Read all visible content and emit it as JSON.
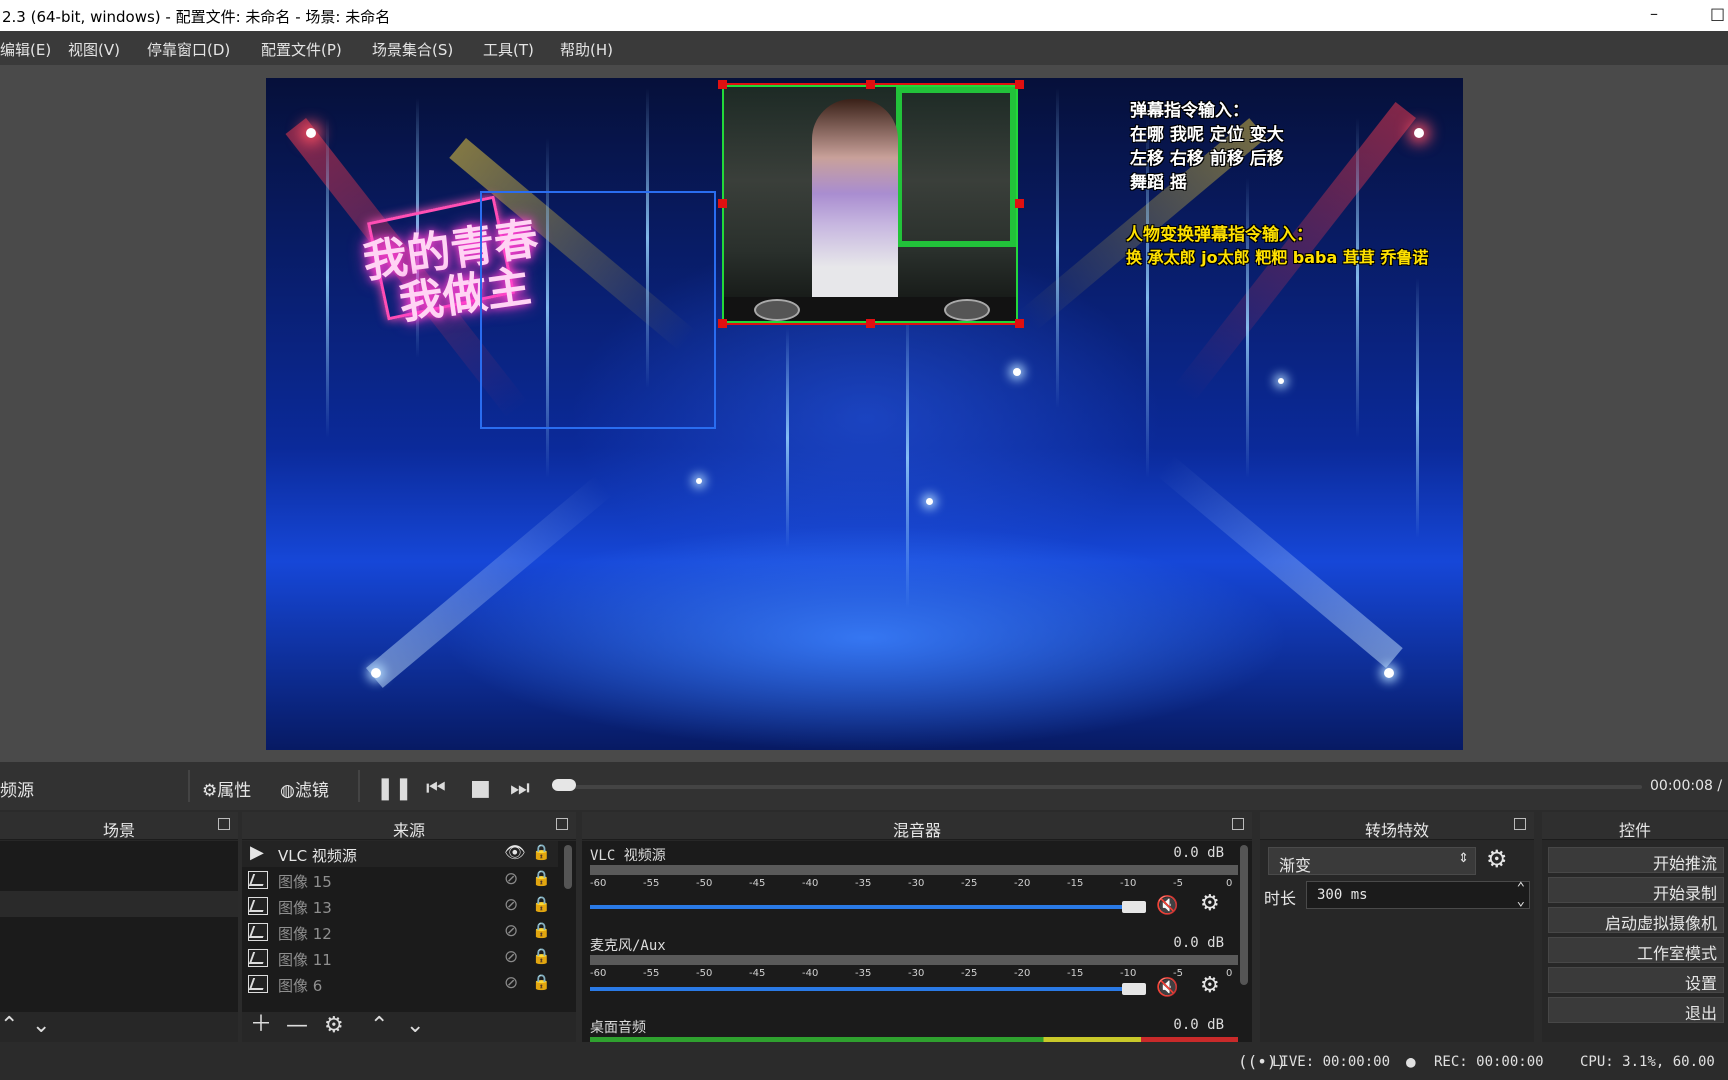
{
  "window": {
    "title": "2.3 (64-bit, windows) - 配置文件: 未命名 - 场景: 未命名",
    "minimize_glyph": "–",
    "maximize_glyph": "□"
  },
  "menu": [
    "编辑(E)",
    "视图(V)",
    "停靠窗口(D)",
    "配置文件(P)",
    "场景集合(S)",
    "工具(T)",
    "帮助(H)"
  ],
  "overlay": {
    "neon_line1": "我的青春",
    "neon_line2": "我做主",
    "danmu_title": "弹幕指令输入：",
    "danmu_line1": "在哪 我呢 定位 变大",
    "danmu_line2": "左移 右移 前移 后移",
    "danmu_line3": "舞蹈 摇",
    "char_title": "人物变换弹幕指令输入：",
    "char_line": "换 承太郎 jo太郎 粑粑 baba 茸茸 乔鲁诺"
  },
  "toolbar": {
    "source_label": "频源",
    "properties": "属性",
    "filters": "滤镜",
    "time": "00:00:08 /",
    "progress": 0.01
  },
  "scenes": {
    "title": "场景"
  },
  "sources": {
    "title": "来源",
    "items": [
      {
        "name": "VLC 视频源",
        "active": true
      },
      {
        "name": "图像 15",
        "active": false
      },
      {
        "name": "图像 13",
        "active": false
      },
      {
        "name": "图像 12",
        "active": false
      },
      {
        "name": "图像 11",
        "active": false
      },
      {
        "name": "图像 6",
        "active": false
      }
    ]
  },
  "mixer": {
    "title": "混音器",
    "ticks": [
      "-60",
      "-55",
      "-50",
      "-45",
      "-40",
      "-35",
      "-30",
      "-25",
      "-20",
      "-15",
      "-10",
      "-5",
      "0"
    ],
    "channels": [
      {
        "name": "VLC 视频源",
        "db": "0.0 dB",
        "volume": 1.0
      },
      {
        "name": "麦克风/Aux",
        "db": "0.0 dB",
        "volume": 1.0
      },
      {
        "name": "桌面音频",
        "db": "0.0 dB",
        "volume": 1.0
      }
    ]
  },
  "transitions": {
    "title": "转场特效",
    "selected": "渐变",
    "duration_label": "时长",
    "duration_value": "300 ms"
  },
  "controls": {
    "title": "控件",
    "buttons": [
      "开始推流",
      "开始录制",
      "启动虚拟摄像机",
      "工作室模式",
      "设置",
      "退出"
    ]
  },
  "status": {
    "live": "LIVE: 00:00:00",
    "rec": "REC: 00:00:00",
    "cpu": "CPU: 3.1%, 60.00"
  },
  "colors": {
    "accent_blue": "#2a7ae6",
    "selection_red": "#e01010",
    "mute_red": "#e01010",
    "caption_yellow": "#ffe100"
  }
}
